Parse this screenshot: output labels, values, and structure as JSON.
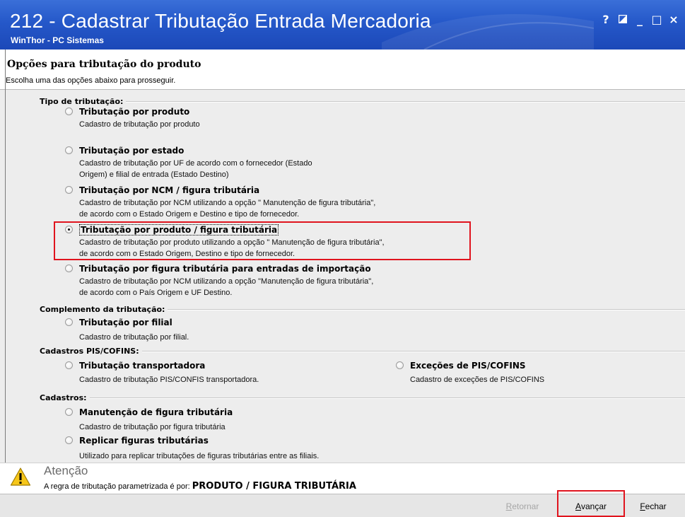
{
  "window": {
    "title": "212 - Cadastrar Tributação Entrada Mercadoria",
    "subtitle": "WinThor - PC Sistemas",
    "controls": {
      "help": "?",
      "restore": "◩",
      "minimize": "_",
      "maximize": "□",
      "close": "×"
    }
  },
  "header": {
    "title": "Opções para tributação do produto",
    "subtitle": "Escolha uma das opções abaixo para prosseguir."
  },
  "groups": {
    "tipo": "Tipo de tributação:",
    "complemento": "Complemento da tributação:",
    "pis": "Cadastros PIS/COFINS:",
    "cadastros": "Cadastros:"
  },
  "options": {
    "por_produto": {
      "label": "Tributação por produto",
      "desc1": "Cadastro de tributação por produto",
      "selected": false
    },
    "por_estado": {
      "label": "Tributação por estado",
      "desc1": "Cadastro de tributação por UF de acordo com o fornecedor (Estado",
      "desc2": "Origem) e filial de entrada (Estado Destino)",
      "selected": false
    },
    "por_ncm": {
      "label": "Tributação por NCM / figura tributária",
      "desc1": "Cadastro de tributação por NCM utilizando a opção \" Manutenção de figura tributária\",",
      "desc2": "de acordo com o Estado Origem e Destino e tipo de fornecedor.",
      "selected": false
    },
    "por_produto_figura": {
      "label": "Tributação por produto / figura tributária",
      "desc1": "Cadastro de tributação por produto utilizando a opção \" Manutenção de figura tributária\",",
      "desc2": "de acordo com o Estado Origem, Destino e tipo de fornecedor.",
      "selected": true
    },
    "importacao": {
      "label": "Tributação por figura tributária para entradas de importação",
      "desc1": "Cadastro de tributação por NCM utilizando a opção \"Manutenção de figura tributária\",",
      "desc2": "de acordo com o País Origem e UF Destino.",
      "selected": false
    },
    "por_filial": {
      "label": "Tributação por filial",
      "desc1": "Cadastro de tributação por filial.",
      "selected": false
    },
    "transportadora": {
      "label": "Tributação  transportadora",
      "desc1": "Cadastro de tributação PIS/CONFIS transportadora.",
      "selected": false
    },
    "excecoes_pis": {
      "label": "Exceções de PIS/COFINS",
      "desc1": "Cadastro de exceções de PIS/COFINS",
      "selected": false
    },
    "manutencao_figura": {
      "label": "Manutenção de figura tributária",
      "desc1": "Cadastro de tributação por figura tributária",
      "selected": false
    },
    "replicar_figuras": {
      "label": "Replicar figuras tributárias",
      "desc1": "Utilizado para replicar tributações de figuras tributárias entre as filiais.",
      "selected": false
    }
  },
  "attention": {
    "title": "Atenção",
    "text": "A regra de tributação parametrizada é por: ",
    "value": "PRODUTO / FIGURA TRIBUTÁRIA"
  },
  "footer": {
    "back": "Retornar",
    "next": "Avançar",
    "close": "Fechar"
  },
  "colors": {
    "titlebar": "#2558c9",
    "highlight": "#e0141e",
    "panel": "#ededed"
  }
}
